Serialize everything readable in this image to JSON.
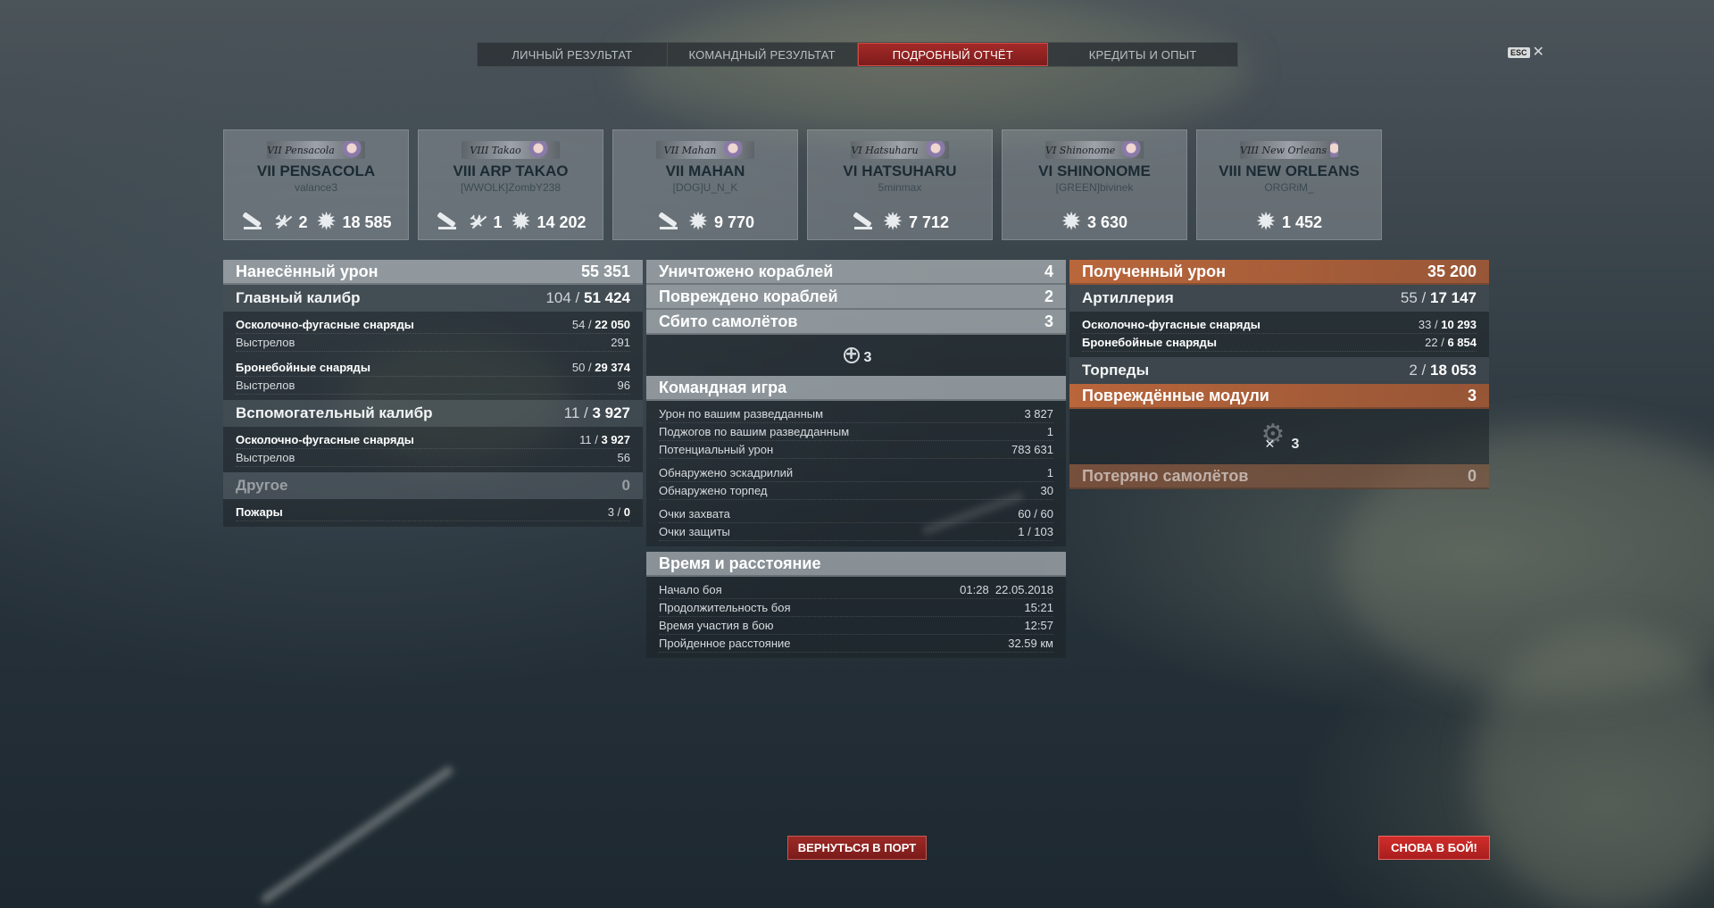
{
  "tabs": [
    {
      "label": "ЛИЧНЫЙ РЕЗУЛЬТАТ",
      "active": false
    },
    {
      "label": "КОМАНДНЫЙ РЕЗУЛЬТАТ",
      "active": false
    },
    {
      "label": "ПОДРОБНЫЙ ОТЧЁТ",
      "active": true
    },
    {
      "label": "КРЕДИТЫ И ОПЫТ",
      "active": false
    }
  ],
  "esc": {
    "key": "ESC",
    "close": "✕"
  },
  "cards": [
    {
      "flag": "VII Pensacola",
      "tier": "VII",
      "name": "PENSACOLA",
      "player": "valance3",
      "kills": "",
      "planes": "2",
      "damage": "18 585"
    },
    {
      "flag": "VIII Takao",
      "tier": "VIII",
      "name": "ARP TAKAO",
      "player": "[WWOLK]ZombY238",
      "kills": "",
      "planes": "1",
      "damage": "14 202"
    },
    {
      "flag": "VII Mahan",
      "tier": "VII",
      "name": "MAHAN",
      "player": "[DOG]U_N_K",
      "kills": "",
      "planes": null,
      "damage": "9 770"
    },
    {
      "flag": "VI Hatsuharu",
      "tier": "VI",
      "name": "HATSUHARU",
      "player": "5minmax",
      "kills": "",
      "planes": null,
      "damage": "7 712"
    },
    {
      "flag": "VI Shinonome",
      "tier": "VI",
      "name": "SHINONOME",
      "player": "[GREEN]bivinek",
      "kills": null,
      "planes": null,
      "damage": "3 630"
    },
    {
      "flag": "VIII New Orleans",
      "tier": "VIII",
      "name": "NEW ORLEANS",
      "player": "ORGRiM_",
      "kills": null,
      "planes": null,
      "damage": "1 452"
    }
  ],
  "left": {
    "dealt": {
      "label": "Нанесённый урон",
      "value": "55 351"
    },
    "main": {
      "label": "Главный калибр",
      "hits": "104",
      "dmg": "51 424"
    },
    "main_rows": [
      {
        "label": "Осколочно-фугасные снаряды",
        "hits": "54",
        "dmg": "22 050",
        "bold": true
      },
      {
        "label": "Выстрелов",
        "value": "291",
        "bold": false
      },
      {
        "label": "Бронебойные снаряды",
        "hits": "50",
        "dmg": "29 374",
        "bold": true
      },
      {
        "label": "Выстрелов",
        "value": "96",
        "bold": false
      }
    ],
    "secondary": {
      "label": "Вспомогательный калибр",
      "hits": "11",
      "dmg": "3 927"
    },
    "secondary_rows": [
      {
        "label": "Осколочно-фугасные снаряды",
        "hits": "11",
        "dmg": "3 927"
      },
      {
        "label": "Выстрелов",
        "value": "56"
      }
    ],
    "other": {
      "label": "Другое",
      "value": "0"
    },
    "fires": {
      "label": "Пожары",
      "hits": "3",
      "dmg": "0"
    }
  },
  "mid": {
    "destroyed": {
      "label": "Уничтожено кораблей",
      "value": "4"
    },
    "damaged": {
      "label": "Повреждено кораблей",
      "value": "2"
    },
    "planes": {
      "label": "Сбито самолётов",
      "value": "3"
    },
    "crosshair_count": "3",
    "team": {
      "label": "Командная игра",
      "rows": [
        {
          "label": "Урон по вашим разведданным",
          "value": "3 827"
        },
        {
          "label": "Поджогов по вашим разведданным",
          "value": "1"
        },
        {
          "label": "Потенциальный урон",
          "value": "783 631"
        },
        {
          "label": "Обнаружено эскадрилий",
          "value": "1"
        },
        {
          "label": "Обнаружено торпед",
          "value": "30"
        },
        {
          "label": "Очки захвата",
          "value": "60 / 60"
        },
        {
          "label": "Очки защиты",
          "value": "1 / 103"
        }
      ]
    },
    "time": {
      "label": "Время и расстояние",
      "rows": [
        {
          "label": "Начало боя",
          "value": "01:28  22.05.2018"
        },
        {
          "label": "Продолжительность боя",
          "value": "15:21"
        },
        {
          "label": "Время участия в бою",
          "value": "12:57"
        },
        {
          "label": "Пройденное расстояние",
          "value": "32.59 км"
        }
      ]
    }
  },
  "right": {
    "received": {
      "label": "Полученный урон",
      "value": "35 200"
    },
    "artillery": {
      "label": "Артиллерия",
      "hits": "55",
      "dmg": "17 147"
    },
    "art_rows": [
      {
        "label": "Осколочно-фугасные снаряды",
        "hits": "33",
        "dmg": "10 293"
      },
      {
        "label": "Бронебойные снаряды",
        "hits": "22",
        "dmg": "6 854"
      }
    ],
    "torpedoes": {
      "label": "Торпеды",
      "hits": "2",
      "dmg": "18 053"
    },
    "modules": {
      "label": "Повреждённые модули",
      "value": "3"
    },
    "modules_count": "3",
    "planes_lost": {
      "label": "Потеряно самолётов",
      "value": "0"
    }
  },
  "buttons": {
    "port": "ВЕРНУТЬСЯ В ПОРТ",
    "battle": "СНОВА В БОЙ!"
  },
  "colors": {
    "accent_red": "#a32a28",
    "damage_orange": "#c0683a"
  }
}
